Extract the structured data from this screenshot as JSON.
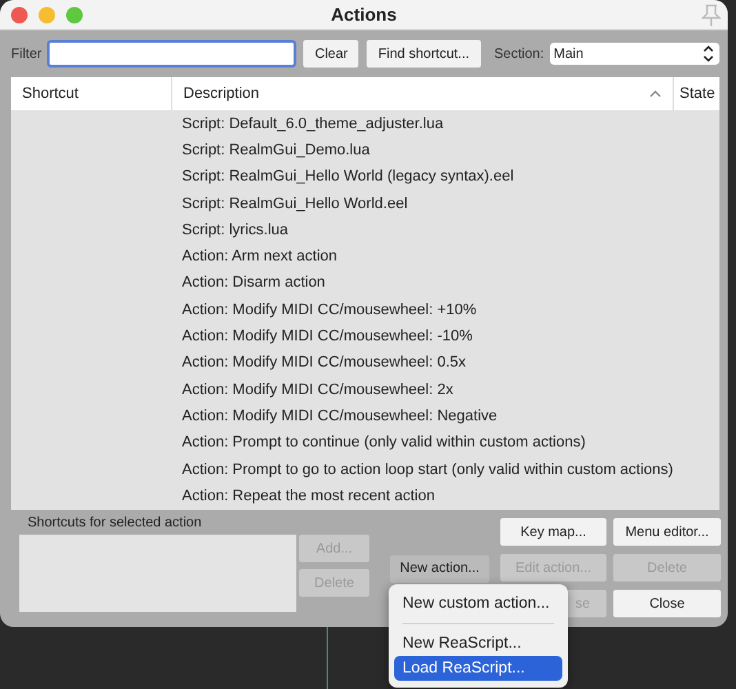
{
  "window": {
    "title": "Actions"
  },
  "filter": {
    "label": "Filter",
    "focused": true
  },
  "toolbar_buttons": [
    {
      "label": "Clear",
      "disabled": false
    },
    {
      "label": "Find shortcut...",
      "disabled": false
    }
  ],
  "section": {
    "label": "Section:",
    "value": "Main"
  },
  "table": {
    "columns": [
      "Shortcut",
      "Description",
      "State"
    ],
    "rows": [
      {
        "description": "Script: Default_6.0_theme_adjuster.lua"
      },
      {
        "description": "Script: RealmGui_Demo.lua"
      },
      {
        "description": "Script: RealmGui_Hello World (legacy syntax).eel"
      },
      {
        "description": "Script: RealmGui_Hello World.eel"
      },
      {
        "description": "Script: lyrics.lua"
      },
      {
        "description": "Action: Arm next action"
      },
      {
        "description": "Action: Disarm action"
      },
      {
        "description": "Action: Modify MIDI CC/mousewheel: +10%"
      },
      {
        "description": "Action: Modify MIDI CC/mousewheel: -10%"
      },
      {
        "description": "Action: Modify MIDI CC/mousewheel: 0.5x"
      },
      {
        "description": "Action: Modify MIDI CC/mousewheel: 2x"
      },
      {
        "description": "Action: Modify MIDI CC/mousewheel: Negative"
      },
      {
        "description": "Action: Prompt to continue (only valid within custom actions)"
      },
      {
        "description": "Action: Prompt to go to action loop start (only valid within custom actions)"
      },
      {
        "description": "Action: Repeat the most recent action"
      }
    ]
  },
  "shortcuts_label": "Shortcuts for selected action",
  "shortcut_buttons": [
    {
      "label": "Add...",
      "disabled": true
    },
    {
      "label": "Delete",
      "disabled": true
    }
  ],
  "new_action_button": {
    "label": "New action...",
    "pressed": true
  },
  "action_buttons": [
    {
      "label": "Key map...",
      "disabled": false
    },
    {
      "label": "Menu editor...",
      "disabled": false
    },
    {
      "label": "Edit action...",
      "disabled": true
    },
    {
      "label": "Delete",
      "disabled": true
    },
    {
      "label": "se",
      "disabled": true
    },
    {
      "label": "Close",
      "disabled": false
    }
  ],
  "menu": [
    {
      "kind": "item",
      "label": "New custom action...",
      "selected": false
    },
    {
      "kind": "separator"
    },
    {
      "kind": "item",
      "label": "New ReaScript...",
      "selected": false
    },
    {
      "kind": "item",
      "label": "Load ReaScript...",
      "selected": true
    }
  ]
}
